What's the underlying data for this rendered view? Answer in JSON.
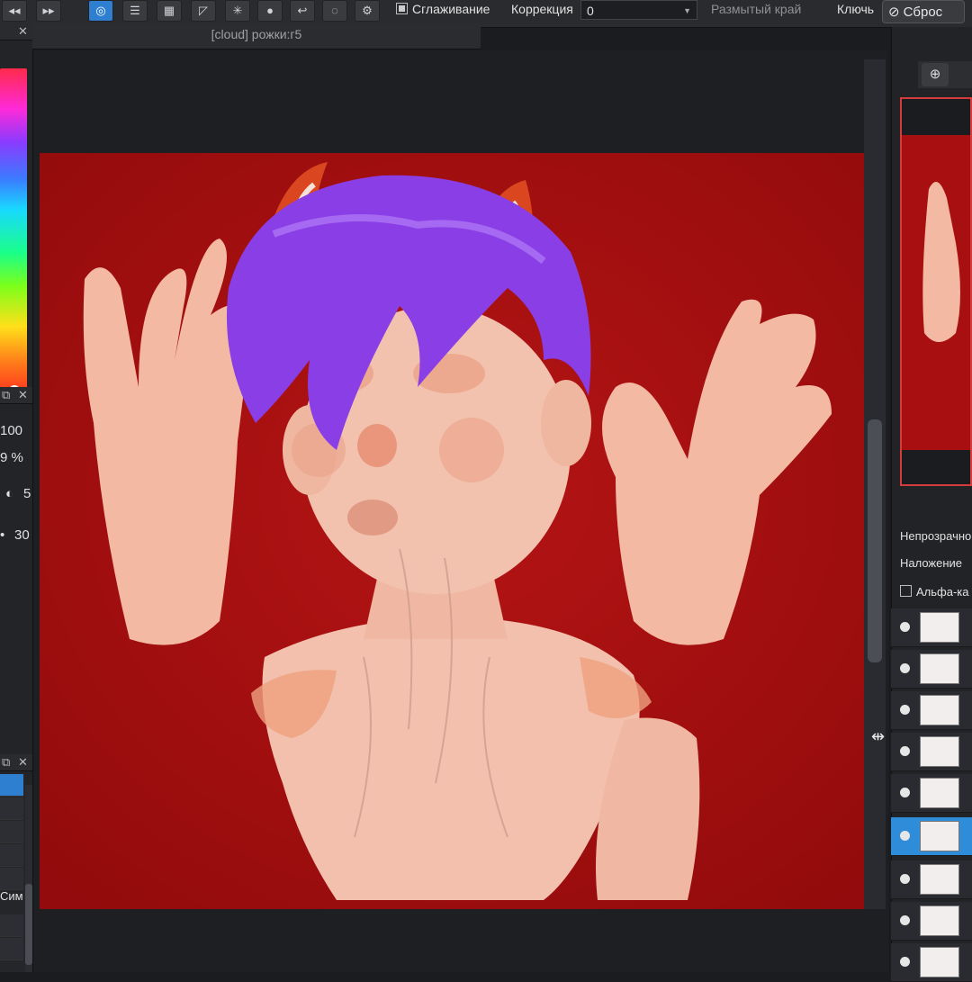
{
  "toolbar": {
    "smoothing_label": "Сглаживание",
    "smoothing_checked": true,
    "correction_label": "Коррекция",
    "correction_value": "0",
    "soft_edge_label": "Размытый край",
    "key_label": "Ключь",
    "reset_label": "Сброс",
    "active_color": "#2f7fd0"
  },
  "document": {
    "title": "[cloud] рожки:г5"
  },
  "left_panel": {
    "value_1": "100",
    "value_2": "9 %",
    "value_3": "5",
    "value_4": "30",
    "grid_label": "Сим"
  },
  "layers_panel": {
    "opacity_label": "Непрозрачно",
    "blending_label": "Наложение",
    "alpha_label": "Альфа-ка",
    "selected_color": "#2e8cd8",
    "rows": [
      "",
      "",
      "",
      "",
      "",
      "",
      "",
      "",
      ""
    ]
  },
  "artwork": {
    "background_color": "#a80f10",
    "hair_color": "#8a3ee6",
    "skin_color": "#f0a48e",
    "horn_color": "#d9461f"
  }
}
